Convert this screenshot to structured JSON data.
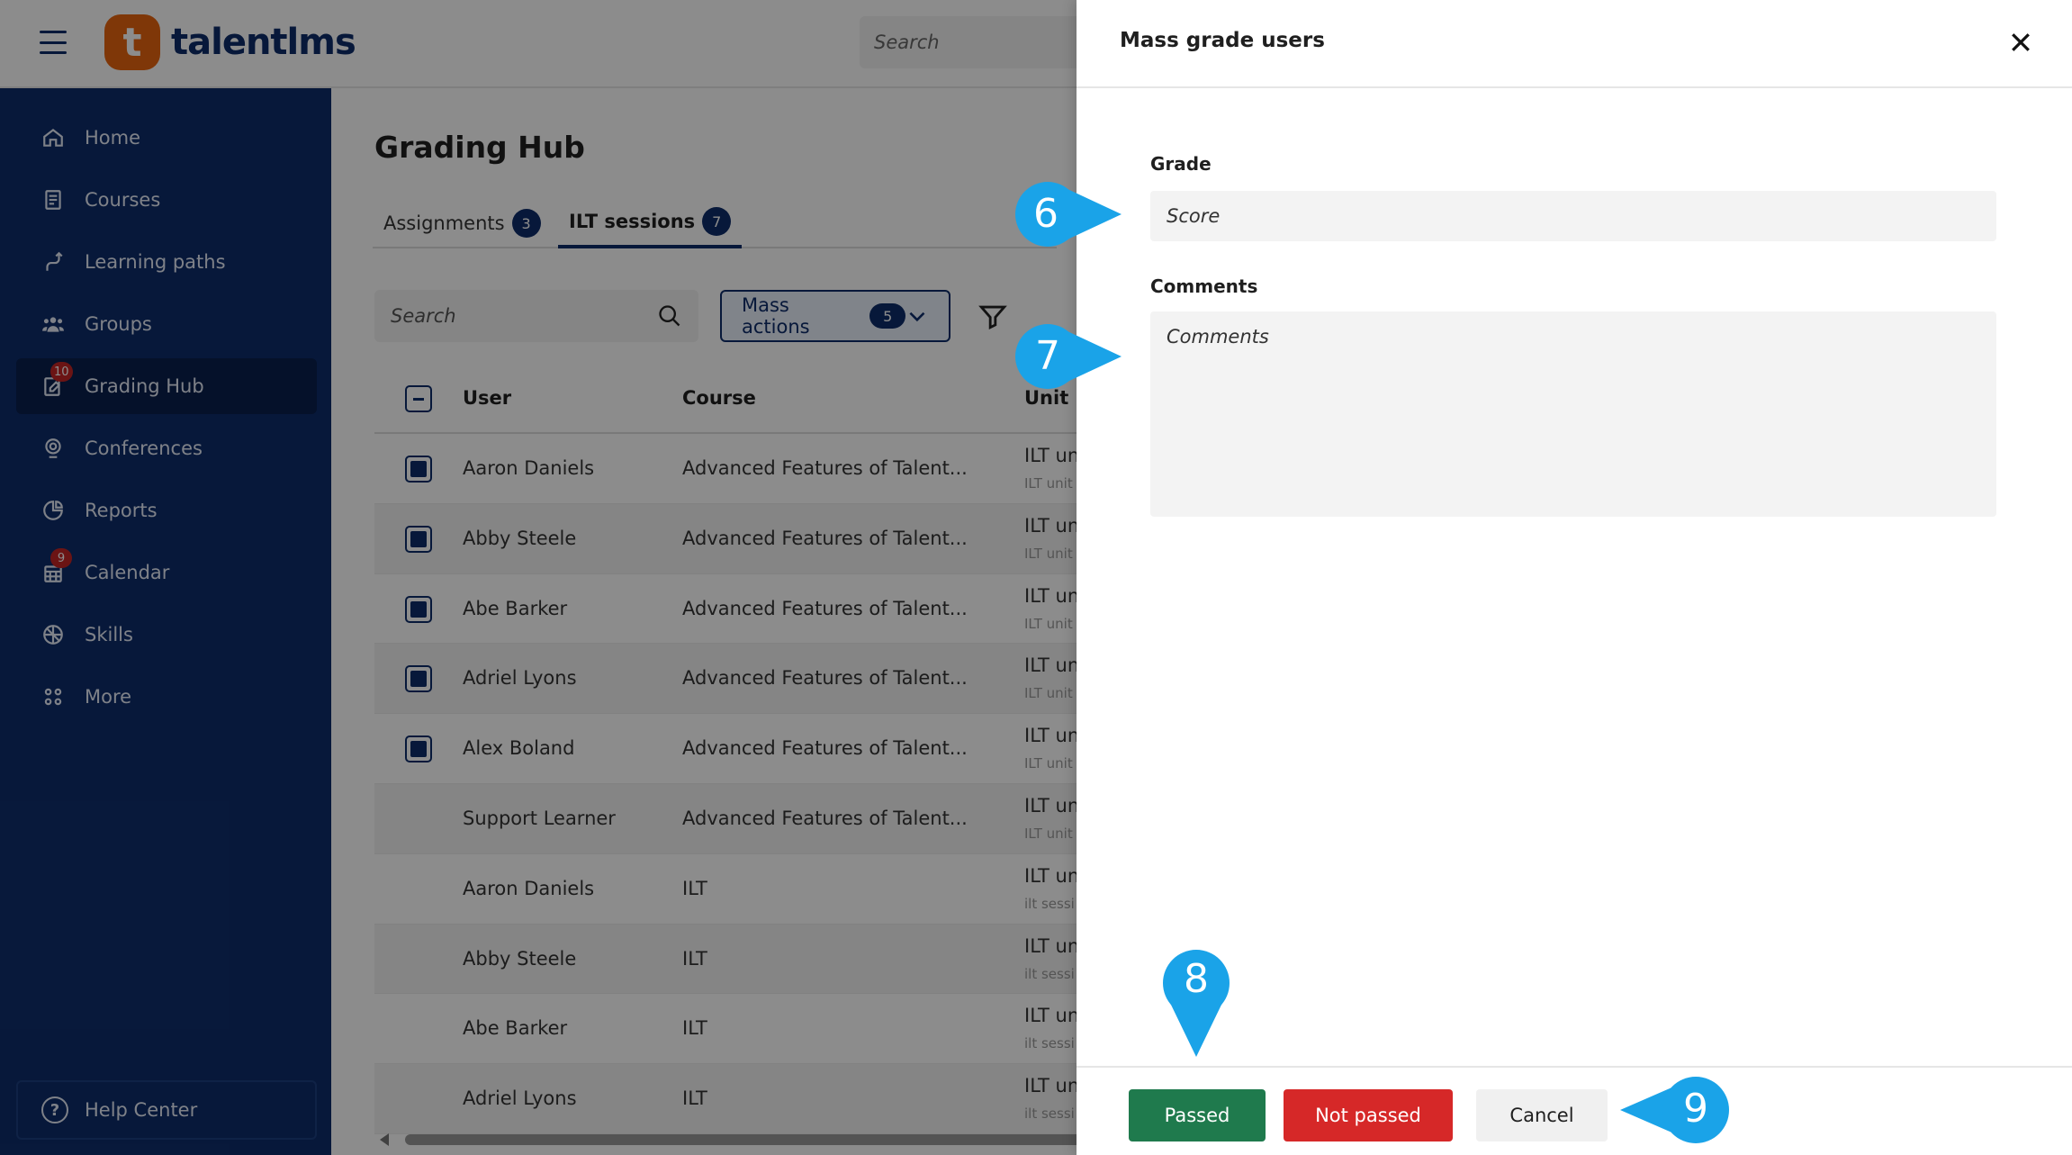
{
  "app": {
    "logo_letter": "t",
    "logo_text": "talentlms",
    "search_placeholder": "Search"
  },
  "sidebar": {
    "items": [
      {
        "label": "Home",
        "icon": "home-icon"
      },
      {
        "label": "Courses",
        "icon": "courses-icon"
      },
      {
        "label": "Learning paths",
        "icon": "learning-paths-icon"
      },
      {
        "label": "Groups",
        "icon": "groups-icon"
      },
      {
        "label": "Grading Hub",
        "icon": "grading-hub-icon",
        "badge": "10",
        "active": true
      },
      {
        "label": "Conferences",
        "icon": "conferences-icon"
      },
      {
        "label": "Reports",
        "icon": "reports-icon"
      },
      {
        "label": "Calendar",
        "icon": "calendar-icon",
        "badge": "9"
      },
      {
        "label": "Skills",
        "icon": "skills-icon"
      },
      {
        "label": "More",
        "icon": "more-icon"
      }
    ],
    "help_label": "Help Center"
  },
  "main": {
    "title": "Grading Hub",
    "tabs": [
      {
        "label": "Assignments",
        "count": "3"
      },
      {
        "label": "ILT sessions",
        "count": "7",
        "active": true
      }
    ],
    "search_placeholder": "Search",
    "mass_actions": {
      "label": "Mass actions",
      "count": "5"
    },
    "table": {
      "headers": {
        "user": "User",
        "course": "Course",
        "unit": "Unit"
      },
      "rows": [
        {
          "user": "Aaron Daniels",
          "course": "Advanced Features of Talent...",
          "unit": "ILT uni",
          "unit_sub": "ILT unit",
          "checked": true
        },
        {
          "user": "Abby Steele",
          "course": "Advanced Features of Talent...",
          "unit": "ILT uni",
          "unit_sub": "ILT unit",
          "checked": true
        },
        {
          "user": "Abe Barker",
          "course": "Advanced Features of Talent...",
          "unit": "ILT uni",
          "unit_sub": "ILT unit",
          "checked": true
        },
        {
          "user": "Adriel Lyons",
          "course": "Advanced Features of Talent...",
          "unit": "ILT uni",
          "unit_sub": "ILT unit",
          "checked": true
        },
        {
          "user": "Alex Boland",
          "course": "Advanced Features of Talent...",
          "unit": "ILT uni",
          "unit_sub": "ILT unit",
          "checked": true
        },
        {
          "user": "Support Learner",
          "course": "Advanced Features of Talent...",
          "unit": "ILT uni",
          "unit_sub": "ILT unit",
          "checked": false
        },
        {
          "user": "Aaron Daniels",
          "course": "ILT",
          "unit": "ILT uni",
          "unit_sub": "ilt sessi",
          "checked": false
        },
        {
          "user": "Abby Steele",
          "course": "ILT",
          "unit": "ILT uni",
          "unit_sub": "ilt sessi",
          "checked": false
        },
        {
          "user": "Abe Barker",
          "course": "ILT",
          "unit": "ILT uni",
          "unit_sub": "ilt sessi",
          "checked": false
        },
        {
          "user": "Adriel Lyons",
          "course": "ILT",
          "unit": "ILT uni",
          "unit_sub": "ilt sessi",
          "checked": false
        }
      ]
    }
  },
  "drawer": {
    "title": "Mass grade users",
    "grade_label": "Grade",
    "grade_placeholder": "Score",
    "comments_label": "Comments",
    "comments_placeholder": "Comments",
    "buttons": {
      "passed": "Passed",
      "not_passed": "Not passed",
      "cancel": "Cancel"
    }
  },
  "callouts": [
    "6",
    "7",
    "8",
    "9"
  ],
  "colors": {
    "brand_navy": "#0e2d6b",
    "brand_orange": "#e8650f",
    "passed_green": "#1f7a4d",
    "not_passed_red": "#d62828",
    "callout_blue": "#1aa3e8"
  }
}
